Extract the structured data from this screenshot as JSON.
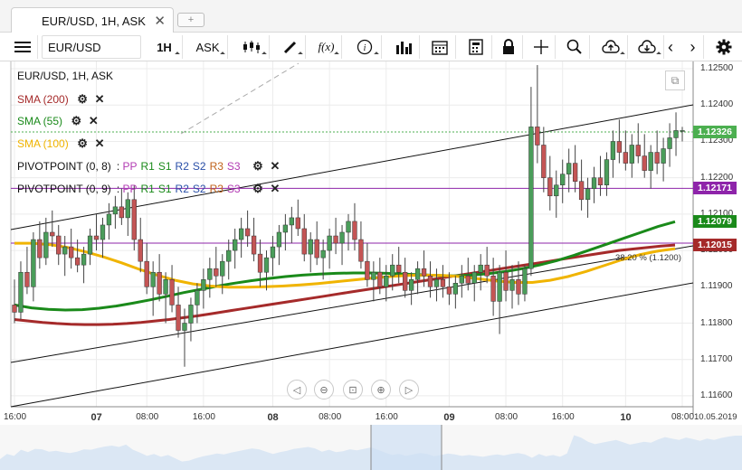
{
  "tab": {
    "title": "EUR/USD, 1H, ASK",
    "close_icon": "close-icon",
    "new_tab_icon": "plus-icon",
    "new_tab_label": "+"
  },
  "toolbar": {
    "menu_icon": "hamburger-icon",
    "symbol": "EUR/USD",
    "timeframe": "1H",
    "side": "ASK",
    "icons": [
      "candlestick-icon",
      "pen-icon",
      "function-icon",
      "info-icon",
      "bar-chart-icon",
      "calendar-icon",
      "calculator-icon",
      "lock-icon",
      "crosshair-icon",
      "zoom-icon",
      "upload-cloud-icon",
      "download-cloud-icon",
      "chevron-left-icon",
      "chevron-right-icon",
      "gear-icon"
    ]
  },
  "legend": {
    "title": "EUR/USD, 1H, ASK",
    "indicators": [
      {
        "label": "SMA (200)",
        "color": "#a52a2a"
      },
      {
        "label": "SMA (55)",
        "color": "#1a8a1a"
      },
      {
        "label": "SMA (100)",
        "color": "#f0b400"
      }
    ],
    "pivots": [
      {
        "label": "PIVOTPOINT (0, 8)",
        "sep": ": ",
        "levels": [
          "PP",
          "R1",
          "S1",
          "R2",
          "S2",
          "R3",
          "S3"
        ]
      },
      {
        "label": "PIVOTPOINT (0, 9)",
        "sep": ": ",
        "levels": [
          "PP",
          "R1",
          "S1",
          "R2",
          "S2",
          "R3",
          "S3"
        ]
      }
    ],
    "level_colors": [
      "#b23bb3",
      "#1a8a1a",
      "#1a8a1a",
      "#2a4fa8",
      "#2a4fa8",
      "#c0621a",
      "#b23bb3"
    ]
  },
  "fib_label": "38.20 % (1.1200)",
  "date_label": "10.05.2019",
  "price_labels": [
    {
      "value": "1.12326",
      "price": 1.12326,
      "color": "#4caf50"
    },
    {
      "value": "1.12171",
      "price": 1.12171,
      "color": "#8e24aa"
    },
    {
      "value": "1.12079",
      "price": 1.12079,
      "color": "#1a8a1a"
    },
    {
      "value": "1.12015",
      "price": 1.12015,
      "color": "#a52a2a"
    }
  ],
  "chart_data": {
    "type": "candlestick",
    "symbol": "EUR/USD",
    "timeframe": "1H",
    "ylim": [
      1.1157,
      1.1252
    ],
    "y_ticks": [
      1.116,
      1.117,
      1.118,
      1.119,
      1.12,
      1.121,
      1.122,
      1.123,
      1.124,
      1.125
    ],
    "y_tick_labels": [
      "1.11600",
      "1.11700",
      "1.11800",
      "1.11900",
      "1.12000",
      "1.12100",
      "1.12200",
      "1.12300",
      "1.12400",
      "1.12500"
    ],
    "x_tick_labels": [
      "16:00",
      "07",
      "08:00",
      "16:00",
      "08",
      "08:00",
      "16:00",
      "09",
      "08:00",
      "16:00",
      "10",
      "08:00"
    ],
    "x_tick_bars": [
      0,
      13,
      21,
      30,
      41,
      50,
      59,
      69,
      78,
      87,
      97,
      106
    ],
    "day_ticks": [
      "07",
      "08",
      "09",
      "10"
    ],
    "candles_ohlc": [
      [
        1.1185,
        1.1192,
        1.118,
        1.1183
      ],
      [
        1.1183,
        1.1197,
        1.1181,
        1.1194
      ],
      [
        1.1194,
        1.1201,
        1.1188,
        1.119
      ],
      [
        1.119,
        1.1205,
        1.1186,
        1.1203
      ],
      [
        1.1203,
        1.1208,
        1.1195,
        1.1198
      ],
      [
        1.1198,
        1.1209,
        1.1196,
        1.1205
      ],
      [
        1.1205,
        1.1211,
        1.1201,
        1.1204
      ],
      [
        1.1204,
        1.1207,
        1.1196,
        1.1199
      ],
      [
        1.1199,
        1.1204,
        1.1193,
        1.1201
      ],
      [
        1.1201,
        1.1206,
        1.1195,
        1.1198
      ],
      [
        1.1198,
        1.1203,
        1.1194,
        1.1196
      ],
      [
        1.1196,
        1.1201,
        1.1191,
        1.1199
      ],
      [
        1.1199,
        1.1206,
        1.1196,
        1.1204
      ],
      [
        1.1204,
        1.121,
        1.12,
        1.1203
      ],
      [
        1.1203,
        1.1209,
        1.1198,
        1.1207
      ],
      [
        1.1207,
        1.1213,
        1.1203,
        1.121
      ],
      [
        1.121,
        1.1215,
        1.1206,
        1.1212
      ],
      [
        1.1212,
        1.1217,
        1.1207,
        1.1209
      ],
      [
        1.1209,
        1.1216,
        1.1204,
        1.1214
      ],
      [
        1.1214,
        1.1218,
        1.12,
        1.1203
      ],
      [
        1.1203,
        1.1209,
        1.1194,
        1.1197
      ],
      [
        1.1197,
        1.1202,
        1.1188,
        1.119
      ],
      [
        1.119,
        1.1197,
        1.1182,
        1.1194
      ],
      [
        1.1194,
        1.1199,
        1.1186,
        1.1188
      ],
      [
        1.1188,
        1.1194,
        1.118,
        1.1192
      ],
      [
        1.1192,
        1.1196,
        1.1183,
        1.1185
      ],
      [
        1.1185,
        1.119,
        1.1176,
        1.1178
      ],
      [
        1.1178,
        1.1184,
        1.1168,
        1.118
      ],
      [
        1.118,
        1.1187,
        1.1175,
        1.1185
      ],
      [
        1.1185,
        1.1191,
        1.118,
        1.1189
      ],
      [
        1.1189,
        1.1195,
        1.1184,
        1.1192
      ],
      [
        1.1192,
        1.1198,
        1.1187,
        1.1195
      ],
      [
        1.1195,
        1.1201,
        1.119,
        1.1193
      ],
      [
        1.1193,
        1.1199,
        1.1188,
        1.1197
      ],
      [
        1.1197,
        1.1203,
        1.1192,
        1.12
      ],
      [
        1.12,
        1.1206,
        1.1195,
        1.1203
      ],
      [
        1.1203,
        1.1209,
        1.1198,
        1.1206
      ],
      [
        1.1206,
        1.1211,
        1.1201,
        1.1204
      ],
      [
        1.1204,
        1.1209,
        1.1197,
        1.1199
      ],
      [
        1.1199,
        1.1203,
        1.119,
        1.1194
      ],
      [
        1.1194,
        1.12,
        1.1189,
        1.1198
      ],
      [
        1.1198,
        1.1204,
        1.1193,
        1.1201
      ],
      [
        1.1201,
        1.1207,
        1.1196,
        1.1205
      ],
      [
        1.1205,
        1.121,
        1.12,
        1.1207
      ],
      [
        1.1207,
        1.1212,
        1.1202,
        1.1209
      ],
      [
        1.1209,
        1.1214,
        1.1204,
        1.1206
      ],
      [
        1.1206,
        1.121,
        1.1197,
        1.1199
      ],
      [
        1.1199,
        1.1205,
        1.1194,
        1.1203
      ],
      [
        1.1203,
        1.1208,
        1.1196,
        1.1198
      ],
      [
        1.1198,
        1.1203,
        1.1192,
        1.12
      ],
      [
        1.12,
        1.1206,
        1.1195,
        1.1204
      ],
      [
        1.1204,
        1.1209,
        1.1199,
        1.1202
      ],
      [
        1.1202,
        1.1207,
        1.1196,
        1.1205
      ],
      [
        1.1205,
        1.121,
        1.12,
        1.1208
      ],
      [
        1.1208,
        1.1213,
        1.12,
        1.1203
      ],
      [
        1.1203,
        1.1208,
        1.1195,
        1.1197
      ],
      [
        1.1197,
        1.1202,
        1.119,
        1.1192
      ],
      [
        1.1192,
        1.1197,
        1.1186,
        1.1194
      ],
      [
        1.1194,
        1.1198,
        1.1188,
        1.119
      ],
      [
        1.119,
        1.1196,
        1.1186,
        1.1193
      ],
      [
        1.1193,
        1.1199,
        1.1189,
        1.1196
      ],
      [
        1.1196,
        1.1201,
        1.1191,
        1.1194
      ],
      [
        1.1194,
        1.1198,
        1.1187,
        1.1189
      ],
      [
        1.1189,
        1.1194,
        1.1185,
        1.1192
      ],
      [
        1.1192,
        1.1197,
        1.1188,
        1.1195
      ],
      [
        1.1195,
        1.12,
        1.119,
        1.1193
      ],
      [
        1.1193,
        1.1197,
        1.1187,
        1.119
      ],
      [
        1.119,
        1.1195,
        1.1186,
        1.1192
      ],
      [
        1.1192,
        1.1196,
        1.1187,
        1.119
      ],
      [
        1.119,
        1.1194,
        1.1185,
        1.1188
      ],
      [
        1.1188,
        1.1193,
        1.1184,
        1.1191
      ],
      [
        1.1191,
        1.1196,
        1.1187,
        1.1193
      ],
      [
        1.1193,
        1.1198,
        1.1189,
        1.1191
      ],
      [
        1.1191,
        1.1196,
        1.1186,
        1.1194
      ],
      [
        1.1194,
        1.1199,
        1.1189,
        1.1196
      ],
      [
        1.1196,
        1.1201,
        1.1191,
        1.1193
      ],
      [
        1.1193,
        1.1198,
        1.1182,
        1.1186
      ],
      [
        1.1186,
        1.1196,
        1.1177,
        1.1194
      ],
      [
        1.1194,
        1.12,
        1.1186,
        1.1189
      ],
      [
        1.1189,
        1.1196,
        1.1184,
        1.1192
      ],
      [
        1.1192,
        1.1197,
        1.1185,
        1.1188
      ],
      [
        1.1188,
        1.1196,
        1.1186,
        1.1195
      ],
      [
        1.1195,
        1.1245,
        1.1193,
        1.1234
      ],
      [
        1.1234,
        1.1251,
        1.1224,
        1.1229
      ],
      [
        1.1229,
        1.1234,
        1.1216,
        1.122
      ],
      [
        1.122,
        1.1226,
        1.1211,
        1.1215
      ],
      [
        1.1215,
        1.1222,
        1.1209,
        1.1218
      ],
      [
        1.1218,
        1.1225,
        1.1213,
        1.1221
      ],
      [
        1.1221,
        1.1228,
        1.1216,
        1.1224
      ],
      [
        1.1224,
        1.1229,
        1.1216,
        1.1219
      ],
      [
        1.1219,
        1.1225,
        1.1211,
        1.1214
      ],
      [
        1.1214,
        1.122,
        1.1209,
        1.1217
      ],
      [
        1.1217,
        1.1223,
        1.1213,
        1.122
      ],
      [
        1.122,
        1.1226,
        1.1215,
        1.1218
      ],
      [
        1.1218,
        1.1227,
        1.1215,
        1.1225
      ],
      [
        1.1225,
        1.1233,
        1.122,
        1.123
      ],
      [
        1.123,
        1.1236,
        1.1224,
        1.1227
      ],
      [
        1.1227,
        1.1233,
        1.1222,
        1.1224
      ],
      [
        1.1224,
        1.1232,
        1.122,
        1.1229
      ],
      [
        1.1229,
        1.1235,
        1.1224,
        1.1226
      ],
      [
        1.1226,
        1.1232,
        1.122,
        1.1222
      ],
      [
        1.1222,
        1.1229,
        1.1217,
        1.1227
      ],
      [
        1.1227,
        1.1233,
        1.1221,
        1.1224
      ],
      [
        1.1224,
        1.1231,
        1.1219,
        1.1228
      ],
      [
        1.1228,
        1.1235,
        1.1223,
        1.1231
      ],
      [
        1.1231,
        1.1238,
        1.1226,
        1.1233
      ],
      [
        1.1233,
        1.1234,
        1.123,
        1.1233
      ]
    ],
    "series": [
      {
        "name": "SMA (200)",
        "color": "#a52a2a",
        "values": [
          1.1181,
          1.11806,
          1.11802,
          1.11799,
          1.11797,
          1.11796,
          1.11796,
          1.11797,
          1.11799,
          1.11802,
          1.11806,
          1.1181,
          1.11815,
          1.1182,
          1.11826,
          1.11832,
          1.11838,
          1.11844,
          1.1185,
          1.11856,
          1.11862,
          1.11868,
          1.11874,
          1.1188,
          1.11886,
          1.11892,
          1.11898,
          1.11904,
          1.1191,
          1.11916,
          1.11922,
          1.11928,
          1.11934,
          1.1194,
          1.11946,
          1.11952,
          1.11958,
          1.11964,
          1.1197,
          1.11976,
          1.11982,
          1.11988,
          1.11994,
          1.12,
          1.12004,
          1.12008,
          1.12012,
          1.12015
        ]
      },
      {
        "name": "SMA (55)",
        "color": "#1a8a1a",
        "values": [
          1.1185,
          1.11842,
          1.11838,
          1.11836,
          1.11837,
          1.11841,
          1.11847,
          1.11855,
          1.11864,
          1.11874,
          1.11884,
          1.11893,
          1.11902,
          1.1191,
          1.11917,
          1.11923,
          1.11928,
          1.11932,
          1.11935,
          1.11937,
          1.11938,
          1.11938,
          1.11937,
          1.11935,
          1.11933,
          1.11931,
          1.1193,
          1.11932,
          1.11936,
          1.11942,
          1.1195,
          1.1196,
          1.11972,
          1.11986,
          1.12002,
          1.12018,
          1.12034,
          1.1205,
          1.12066,
          1.12079
        ]
      },
      {
        "name": "SMA (100)",
        "color": "#f0b400",
        "values": [
          1.1202,
          1.1202,
          1.12016,
          1.12008,
          1.11996,
          1.11982,
          1.11966,
          1.11948,
          1.11932,
          1.11918,
          1.11908,
          1.11902,
          1.11899,
          1.11899,
          1.119,
          1.11902,
          1.11905,
          1.11909,
          1.11914,
          1.11919,
          1.11924,
          1.11928,
          1.11931,
          1.11932,
          1.11931,
          1.11928,
          1.11922,
          1.11916,
          1.11912,
          1.11912,
          1.11918,
          1.11928,
          1.11942,
          1.11958,
          1.11974,
          1.11988,
          1.11998,
          1.12005
        ]
      }
    ],
    "horizontal_levels": [
      {
        "price": 1.12326,
        "color": "#4caf50",
        "style": "dotted"
      },
      {
        "price": 1.12171,
        "color": "#8e24aa",
        "style": "solid"
      },
      {
        "price": 1.1202,
        "color": "#8e24aa",
        "style": "solid"
      }
    ],
    "fib_level": {
      "label": "38.20 % (1.1200)",
      "price": 1.12
    },
    "grid": true
  }
}
